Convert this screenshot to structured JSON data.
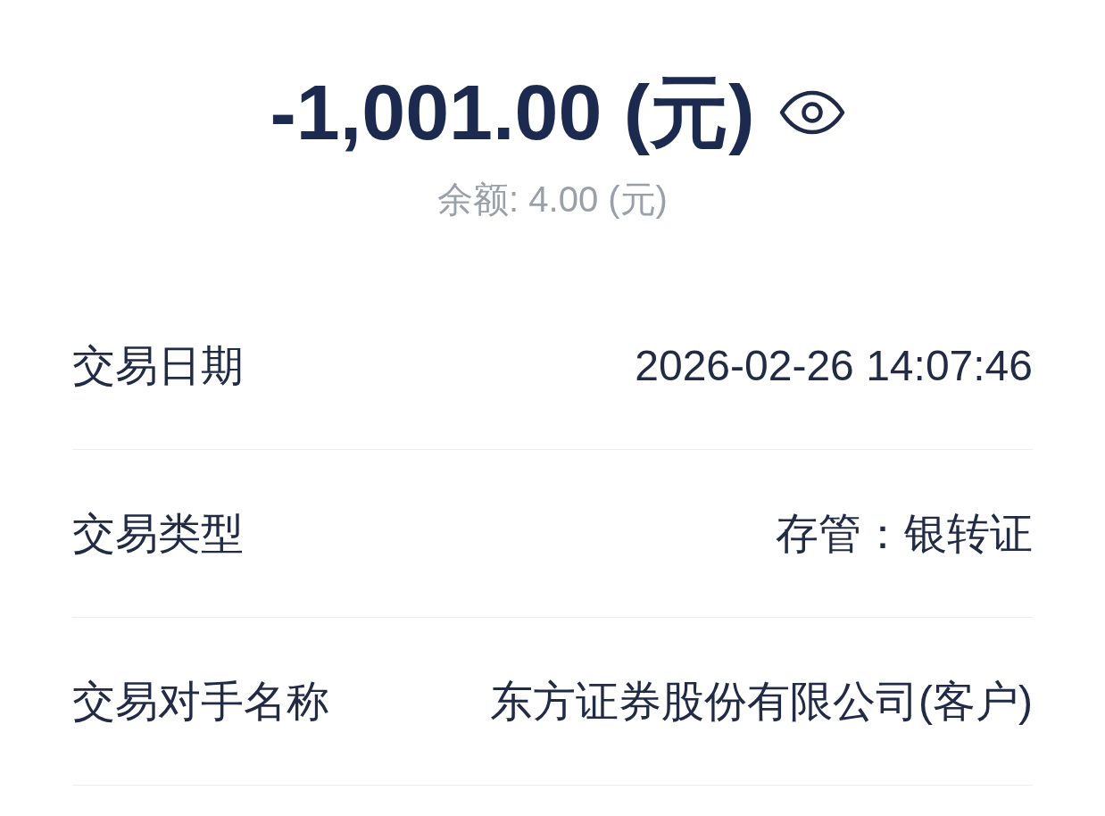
{
  "summary": {
    "amount": "-1,001.00 (元)",
    "balance": "余额: 4.00 (元)"
  },
  "details": [
    {
      "label": "交易日期",
      "value": "2026-02-26 14:07:46"
    },
    {
      "label": "交易类型",
      "value": "存管：银转证"
    },
    {
      "label": "交易对手名称",
      "value": "东方证券股份有限公司(客户)"
    }
  ]
}
